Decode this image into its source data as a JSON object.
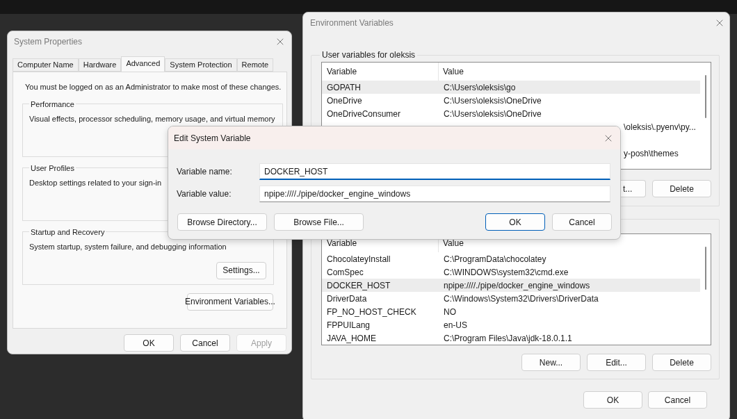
{
  "system_properties": {
    "title": "System Properties",
    "tabs": [
      {
        "label": "Computer Name",
        "selected": false
      },
      {
        "label": "Hardware",
        "selected": false
      },
      {
        "label": "Advanced",
        "selected": true
      },
      {
        "label": "System Protection",
        "selected": false
      },
      {
        "label": "Remote",
        "selected": false
      }
    ],
    "notice": "You must be logged on as an Administrator to make most of these changes.",
    "groups": [
      {
        "title": "Performance",
        "description": "Visual effects, processor scheduling, memory usage, and virtual memory"
      },
      {
        "title": "User Profiles",
        "description": "Desktop settings related to your sign-in"
      },
      {
        "title": "Startup and Recovery",
        "description": "System startup, system failure, and debugging information",
        "button": "Settings..."
      }
    ],
    "env_button": "Environment Variables...",
    "buttons": [
      {
        "label": "OK",
        "disabled": false
      },
      {
        "label": "Cancel",
        "disabled": false
      },
      {
        "label": "Apply",
        "disabled": true
      }
    ]
  },
  "environment_variables": {
    "title": "Environment Variables",
    "user_group": {
      "title": "User variables for oleksis",
      "columns": [
        "Variable",
        "Value"
      ],
      "rows": [
        {
          "variable": "GOPATH",
          "value": "C:\\Users\\oleksis\\go",
          "selected": true
        },
        {
          "variable": "OneDrive",
          "value": "C:\\Users\\oleksis\\OneDrive",
          "selected": false
        },
        {
          "variable": "OneDriveConsumer",
          "value": "C:\\Users\\oleksis\\OneDrive",
          "selected": false
        }
      ],
      "partial_values": [
        "\\oleksis\\.pyenv\\py...",
        "y-posh\\themes"
      ],
      "buttons": [
        {
          "label": "t...",
          "kind": "partial"
        },
        {
          "label": "Delete",
          "kind": "full"
        }
      ]
    },
    "system_group": {
      "columns": [
        "Variable",
        "Value"
      ],
      "rows": [
        {
          "variable": "ChocolateyInstall",
          "value": "C:\\ProgramData\\chocolatey",
          "selected": false
        },
        {
          "variable": "ComSpec",
          "value": "C:\\WINDOWS\\system32\\cmd.exe",
          "selected": false
        },
        {
          "variable": "DOCKER_HOST",
          "value": "npipe:////./pipe/docker_engine_windows",
          "selected": true
        },
        {
          "variable": "DriverData",
          "value": "C:\\Windows\\System32\\Drivers\\DriverData",
          "selected": false
        },
        {
          "variable": "FP_NO_HOST_CHECK",
          "value": "NO",
          "selected": false
        },
        {
          "variable": "FPPUILang",
          "value": "en-US",
          "selected": false
        },
        {
          "variable": "JAVA_HOME",
          "value": "C:\\Program Files\\Java\\jdk-18.0.1.1",
          "selected": false
        }
      ],
      "buttons": [
        "New...",
        "Edit...",
        "Delete"
      ]
    },
    "buttons": [
      "OK",
      "Cancel"
    ]
  },
  "edit_dialog": {
    "title": "Edit System Variable",
    "fields": [
      {
        "label": "Variable name:",
        "value": "DOCKER_HOST",
        "focused": true
      },
      {
        "label": "Variable value:",
        "value": "npipe:////./pipe/docker_engine_windows",
        "focused": false
      }
    ],
    "buttons": [
      {
        "label": "Browse Directory...",
        "default": false
      },
      {
        "label": "Browse File...",
        "default": false
      },
      {
        "label": "OK",
        "default": true
      },
      {
        "label": "Cancel",
        "default": false
      }
    ]
  }
}
